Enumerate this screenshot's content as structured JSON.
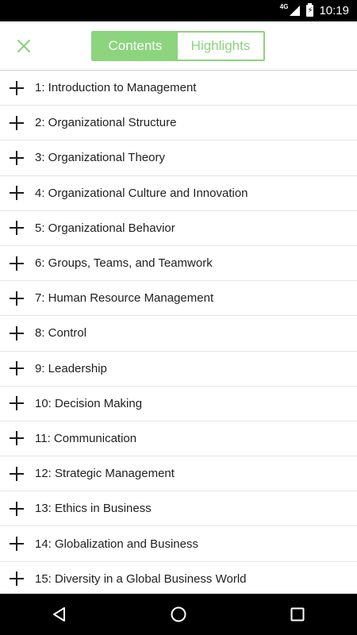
{
  "status_bar": {
    "network": "4G",
    "time": "10:19"
  },
  "header": {
    "close_icon": "close-x-icon",
    "tabs": [
      {
        "label": "Contents",
        "active": true
      },
      {
        "label": "Highlights",
        "active": false
      }
    ]
  },
  "chapters": [
    {
      "label": "1: Introduction to Management"
    },
    {
      "label": "2: Organizational Structure"
    },
    {
      "label": "3: Organizational Theory"
    },
    {
      "label": "4: Organizational Culture and Innovation"
    },
    {
      "label": "5: Organizational Behavior"
    },
    {
      "label": "6: Groups, Teams, and Teamwork"
    },
    {
      "label": "7: Human Resource Management"
    },
    {
      "label": "8: Control"
    },
    {
      "label": "9: Leadership"
    },
    {
      "label": "10: Decision Making"
    },
    {
      "label": "11: Communication"
    },
    {
      "label": "12: Strategic Management"
    },
    {
      "label": "13: Ethics in Business"
    },
    {
      "label": "14: Globalization and Business"
    },
    {
      "label": "15: Diversity in a Global Business World"
    }
  ],
  "colors": {
    "accent": "#8cd47d",
    "text": "#1f1f1f",
    "divider": "#e6e6e6"
  },
  "nav_bar": {
    "icons": [
      "back-triangle-icon",
      "home-circle-icon",
      "recents-square-icon"
    ]
  }
}
